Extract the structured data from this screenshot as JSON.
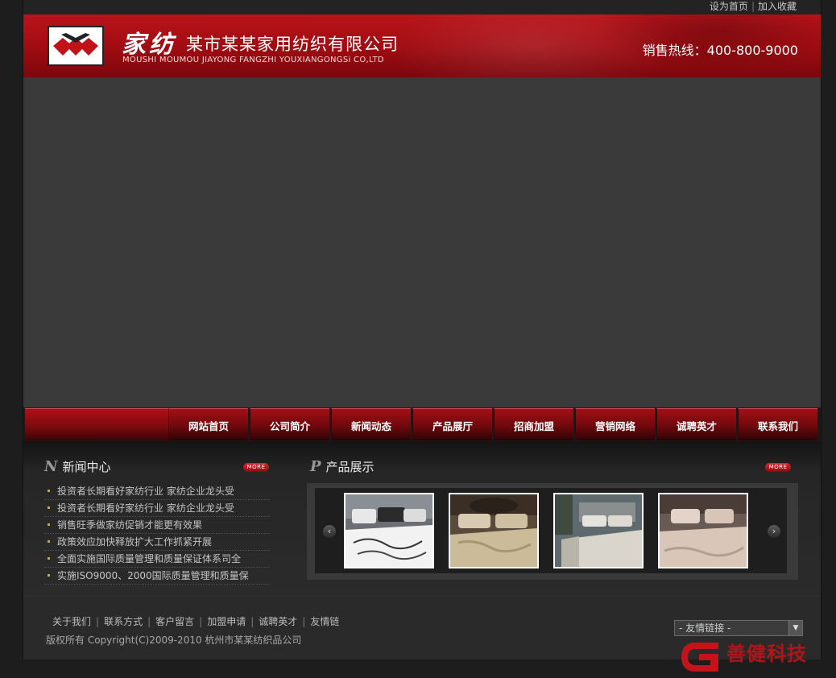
{
  "top_links": {
    "set_home": "设为首页",
    "separator": "|",
    "bookmark": "加入收藏"
  },
  "header": {
    "brand_cn": "家纺",
    "company_name": "某市某某家用纺织有限公司",
    "company_en": "MOUSHI MOUMOU JIAYONG FANGZHI YOUXIANGONGSi CO,LTD",
    "hotline": "销售热线：400-800-9000",
    "logo_icon": "diamond-logo-icon",
    "accent_color": "#a50d13"
  },
  "nav": {
    "items": [
      {
        "label": "网站首页"
      },
      {
        "label": "公司简介"
      },
      {
        "label": "新闻动态"
      },
      {
        "label": "产品展厅"
      },
      {
        "label": "招商加盟"
      },
      {
        "label": "营销网络"
      },
      {
        "label": "诚聘英才"
      },
      {
        "label": "联系我们"
      }
    ]
  },
  "news": {
    "letter": "N",
    "title": "新闻中心",
    "more": "MORE",
    "items": [
      "投资者长期看好家纺行业 家纺企业龙头受",
      "投资者长期看好家纺行业 家纺企业龙头受",
      "销售旺季做家纺促销才能更有效果",
      "政策效应加快释放扩大工作抓紧开展",
      "全面实施国际质量管理和质量保证体系司全",
      "实施ISO9000、2000国际质量管理和质量保"
    ]
  },
  "products": {
    "letter": "P",
    "title": "产品展示",
    "more": "MORE",
    "prev_icon": "‹",
    "next_icon": "›",
    "items": [
      {
        "name": "bedding-photo-grey-white"
      },
      {
        "name": "bedding-photo-beige-damask"
      },
      {
        "name": "bedding-photo-silver"
      },
      {
        "name": "bedding-photo-pink-beige"
      }
    ]
  },
  "footer": {
    "links": [
      "关于我们",
      "联系方式",
      "客户留言",
      "加盟申请",
      "诚聘英才",
      "友情链"
    ],
    "separator": "|",
    "copyright": "版权所有 Copyright(C)2009-2010 杭州市某某纺织品公司",
    "friend_links_select": "- 友情链接 -",
    "select_caret": "▼"
  },
  "watermark": {
    "text": "善健科技"
  }
}
